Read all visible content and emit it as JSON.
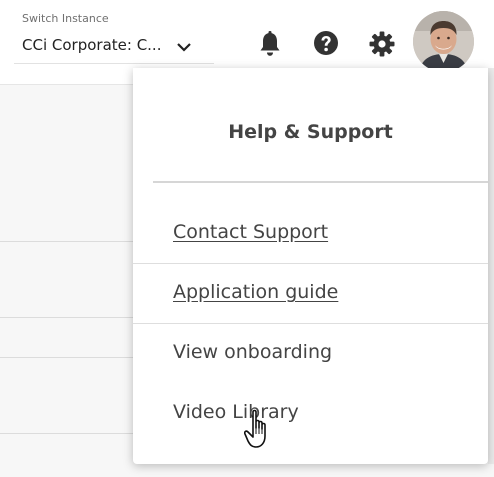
{
  "instance_switcher": {
    "label": "Switch Instance",
    "value": "CCi Corporate: C..."
  },
  "header_icons": [
    "bell-icon",
    "help-icon",
    "gear-icon",
    "avatar"
  ],
  "help_panel": {
    "title": "Help & Support",
    "items": [
      {
        "label": "Contact Support",
        "style": "link"
      },
      {
        "label": "Application guide",
        "style": "link"
      },
      {
        "label": "View onboarding",
        "style": "plain"
      },
      {
        "label": "Video Library",
        "style": "plain"
      }
    ]
  },
  "colors": {
    "text_primary": "#444444",
    "icon": "#333333",
    "divider": "#d6d6d6",
    "background": "#f7f7f7"
  }
}
